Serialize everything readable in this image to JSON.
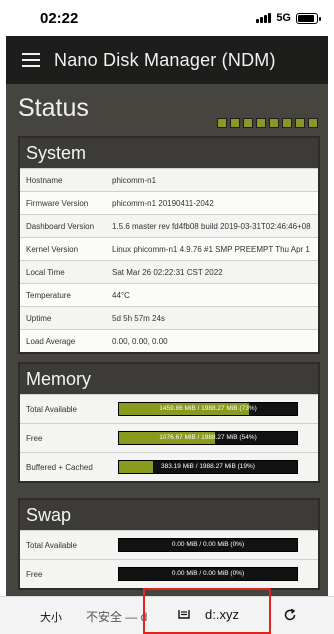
{
  "status_bar": {
    "time": "02:22",
    "network": "5G",
    "battery_level": 0.9
  },
  "app": {
    "title": "Nano Disk Manager (NDM)",
    "heading": "Status",
    "led_count": 8,
    "led_color": "#8c9728"
  },
  "system": {
    "title": "System",
    "rows": [
      {
        "key": "Hostname",
        "value": "phicomm-n1"
      },
      {
        "key": "Firmware Version",
        "value": "phicomm-n1 20190411-2042"
      },
      {
        "key": "Dashboard Version",
        "value": "1.5.6 master rev fd4fb08 build 2019-03-31T02:46:46+08"
      },
      {
        "key": "Kernel Version",
        "value": "Linux phicomm-n1 4.9.76 #1 SMP PREEMPT Thu Apr 1"
      },
      {
        "key": "Local Time",
        "value": "Sat Mar 26 02:22:31 CST 2022"
      },
      {
        "key": "Temperature",
        "value": "44°C"
      },
      {
        "key": "Uptime",
        "value": "5d 5h 57m 24s"
      },
      {
        "key": "Load Average",
        "value": "0.00, 0.00, 0.00"
      }
    ]
  },
  "memory": {
    "title": "Memory",
    "rows": [
      {
        "key": "Total Available",
        "text": "1459.86 MiB / 1988.27 MiB (73%)",
        "fraction": 0.73
      },
      {
        "key": "Free",
        "text": "1076.67 MiB / 1988.27 MiB (54%)",
        "fraction": 0.54
      },
      {
        "key": "Buffered + Cached",
        "text": "383.19 MiB / 1988.27 MiB (19%)",
        "fraction": 0.19
      }
    ]
  },
  "swap": {
    "title": "Swap",
    "rows": [
      {
        "key": "Total Available",
        "text": "0.00 MiB / 0.00 MiB (0%)",
        "fraction": 0
      },
      {
        "key": "Free",
        "text": "0.00 MiB / 0.00 MiB (0%)",
        "fraction": 0
      }
    ]
  },
  "browser": {
    "font_size_label": "大小",
    "insecure_label": "不安全 — d",
    "url_label": "d:.xyz",
    "accent_color": "#8a9a1e",
    "highlight_color": "#e0251b"
  }
}
